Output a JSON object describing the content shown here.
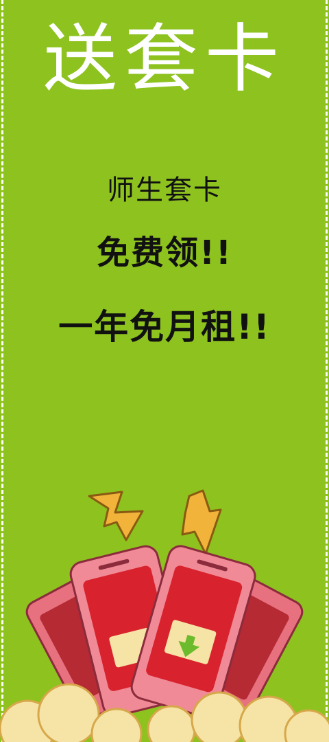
{
  "title": "送套卡",
  "lines": {
    "line1": "师生套卡",
    "line2": "免费领!!",
    "line3": "一年免月租!!"
  },
  "illustration": {
    "icon": "phones-with-lightning-illustration",
    "colors": {
      "background": "#8dc21f",
      "phone_body": "#e8717f",
      "phone_screen": "#d8232e",
      "lightning": "#f2b33a",
      "cloud": "#f6e3a6"
    }
  }
}
